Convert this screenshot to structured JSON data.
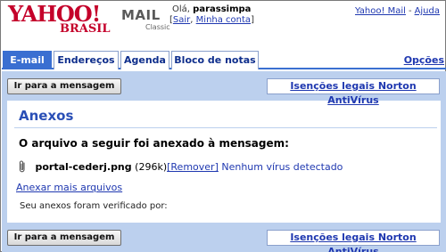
{
  "header": {
    "logo_text": "YAHOO!",
    "logo_sub": "BRASIL",
    "product": "MAIL",
    "product_sub": "Classic",
    "greeting_prefix": "Olá,",
    "username": "parassimpa",
    "link_open": "[",
    "sign_out": "Sair",
    "link_sep": ",",
    "my_account": "Minha conta",
    "link_close": "]",
    "top_links": [
      "Yahoo! Mail",
      "Ajuda"
    ],
    "top_links_sep": "-"
  },
  "tabs": [
    {
      "label": "E-mail",
      "active": true
    },
    {
      "label": "Endereços",
      "active": false
    },
    {
      "label": "Agenda",
      "active": false
    },
    {
      "label": "Bloco de notas",
      "active": false
    }
  ],
  "options_label": "Opções",
  "toolbar": {
    "goto_message_label": "Ir para a mensagem",
    "norton_link": "Isenções legais Norton AntiVírus"
  },
  "page": {
    "title": "Anexos",
    "subhead": "O arquivo a seguir foi anexado à mensagem:",
    "attachment": {
      "icon": "paperclip-icon",
      "filename": "portal-cederj.png",
      "size": "(296k)",
      "remove_label": "[Remover]",
      "virus_status": "Nenhum vírus detectado"
    },
    "attach_more": "Anexar mais arquivos",
    "scanned_by": "Seu anexos foram verificado por:"
  },
  "colors": {
    "accent": "#3a6fd1",
    "panel": "#bcd0ee",
    "link": "#1f38b0",
    "brand": "#c4002a"
  }
}
